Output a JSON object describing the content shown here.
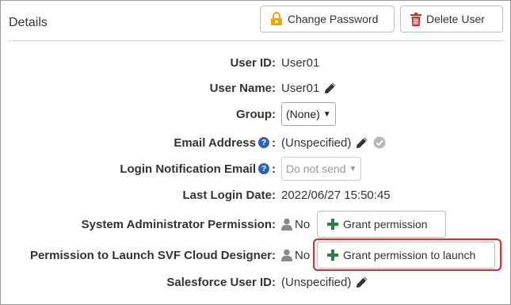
{
  "header": {
    "title": "Details",
    "change_password_label": "Change Password",
    "delete_user_label": "Delete User"
  },
  "fields": {
    "user_id": {
      "label": "User ID:",
      "value": "User01"
    },
    "user_name": {
      "label": "User Name:",
      "value": "User01"
    },
    "group": {
      "label": "Group:",
      "selected": "(None)"
    },
    "email": {
      "label": "Email Address",
      "value": "(Unspecified)"
    },
    "login_notification": {
      "label": "Login Notification Email",
      "selected": "Do not send"
    },
    "last_login": {
      "label": "Last Login Date:",
      "value": "2022/06/27 15:50:45"
    },
    "sys_admin": {
      "label": "System Administrator Permission:",
      "status": "No",
      "button": "Grant permission"
    },
    "svf_launch": {
      "label": "Permission to Launch SVF Cloud Designer:",
      "status": "No",
      "button": "Grant permission to launch"
    },
    "salesforce": {
      "label": "Salesforce User ID:",
      "value": "(Unspecified)"
    }
  },
  "colors": {
    "lock_icon": "#f0a800",
    "trash_icon": "#c9302c",
    "plus_icon": "#2e7d4f",
    "help_icon": "#2a63b8",
    "highlight": "#e3262f"
  }
}
